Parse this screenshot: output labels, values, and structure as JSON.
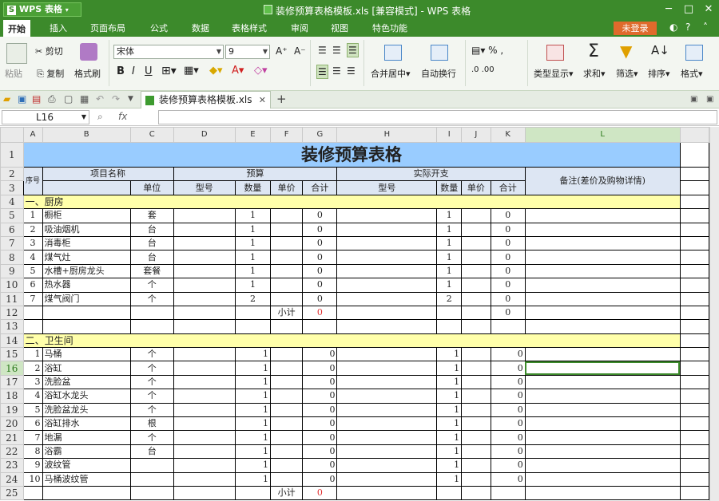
{
  "app": {
    "name": "WPS 表格",
    "title": "装修预算表格模板.xls [兼容模式] - WPS 表格"
  },
  "menu": [
    "开始",
    "插入",
    "页面布局",
    "公式",
    "数据",
    "表格样式",
    "审阅",
    "视图",
    "特色功能"
  ],
  "login": "未登录",
  "ribbon": {
    "paste": "粘贴",
    "cut": "剪切",
    "copy": "复制",
    "format_painter": "格式刷",
    "font_name": "宋体",
    "font_size": "9",
    "merge": "合并居中",
    "wrap": "自动换行",
    "showhide": "类型显示",
    "sum": "求和",
    "filter": "筛选",
    "sort": "排序",
    "format": "格式"
  },
  "file_tab": "装修预算表格模板.xls",
  "namebox": "L16",
  "fx": "fx",
  "columns": [
    "A",
    "B",
    "C",
    "D",
    "E",
    "F",
    "G",
    "H",
    "I",
    "J",
    "K",
    "L"
  ],
  "colors": {
    "green": "#3c8a2b",
    "title_bg": "#99ccff",
    "section_bg": "#ffffaa",
    "login": "#e06a2c"
  },
  "sheet": {
    "title": "装修预算表格",
    "h_seq": "序号",
    "h_item": "项目名称",
    "h_unit": "单位",
    "h_budget": "预算",
    "h_actual": "实际开支",
    "h_model": "型号",
    "h_qty": "数量",
    "h_price": "单价",
    "h_total": "合计",
    "h_note": "备注(差价及购物详情)",
    "section1": "一、厨房",
    "section2": "二、卫生间",
    "subtotal": "小计",
    "kitchen": [
      {
        "row": "5",
        "seq": "1",
        "name": "橱柜",
        "unit": "套",
        "qty": "1",
        "total": "0",
        "aqty": "1",
        "atotal": "0"
      },
      {
        "row": "6",
        "seq": "2",
        "name": "吸油烟机",
        "unit": "台",
        "qty": "1",
        "total": "0",
        "aqty": "1",
        "atotal": "0"
      },
      {
        "row": "7",
        "seq": "3",
        "name": "消毒柜",
        "unit": "台",
        "qty": "1",
        "total": "0",
        "aqty": "1",
        "atotal": "0"
      },
      {
        "row": "8",
        "seq": "4",
        "name": "煤气灶",
        "unit": "台",
        "qty": "1",
        "total": "0",
        "aqty": "1",
        "atotal": "0"
      },
      {
        "row": "9",
        "seq": "5",
        "name": "水槽+厨房龙头",
        "unit": "套餐",
        "qty": "1",
        "total": "0",
        "aqty": "1",
        "atotal": "0"
      },
      {
        "row": "10",
        "seq": "6",
        "name": "热水器",
        "unit": "个",
        "qty": "1",
        "total": "0",
        "aqty": "1",
        "atotal": "0"
      },
      {
        "row": "11",
        "seq": "7",
        "name": "煤气阀门",
        "unit": "个",
        "qty": "2",
        "total": "0",
        "aqty": "2",
        "atotal": "0"
      }
    ],
    "kitchen_subtotal": {
      "row": "12",
      "total": "0",
      "atotal": "0"
    },
    "row13": "13",
    "row14": "14",
    "bathroom": [
      {
        "row": "15",
        "seq": "1",
        "name": "马桶",
        "unit": "个",
        "qty": "1",
        "total": "0",
        "aqty": "1",
        "atotal": "0"
      },
      {
        "row": "16",
        "seq": "2",
        "name": "浴缸",
        "unit": "个",
        "qty": "1",
        "total": "0",
        "aqty": "1",
        "atotal": "0"
      },
      {
        "row": "17",
        "seq": "3",
        "name": "洗脸盆",
        "unit": "个",
        "qty": "1",
        "total": "0",
        "aqty": "1",
        "atotal": "0"
      },
      {
        "row": "18",
        "seq": "4",
        "name": "浴缸水龙头",
        "unit": "个",
        "qty": "1",
        "total": "0",
        "aqty": "1",
        "atotal": "0"
      },
      {
        "row": "19",
        "seq": "5",
        "name": "洗脸盆龙头",
        "unit": "个",
        "qty": "1",
        "total": "0",
        "aqty": "1",
        "atotal": "0"
      },
      {
        "row": "20",
        "seq": "6",
        "name": "浴缸排水",
        "unit": "根",
        "qty": "1",
        "total": "0",
        "aqty": "1",
        "atotal": "0"
      },
      {
        "row": "21",
        "seq": "7",
        "name": "地漏",
        "unit": "个",
        "qty": "1",
        "total": "0",
        "aqty": "1",
        "atotal": "0"
      },
      {
        "row": "22",
        "seq": "8",
        "name": "浴霸",
        "unit": "台",
        "qty": "1",
        "total": "0",
        "aqty": "1",
        "atotal": "0"
      },
      {
        "row": "23",
        "seq": "9",
        "name": "波纹管",
        "unit": "",
        "qty": "1",
        "total": "0",
        "aqty": "1",
        "atotal": "0"
      },
      {
        "row": "24",
        "seq": "10",
        "name": "马桶波纹管",
        "unit": "",
        "qty": "1",
        "total": "0",
        "aqty": "1",
        "atotal": "0"
      }
    ],
    "bath_subtotal": {
      "row": "25",
      "total": "0"
    }
  }
}
